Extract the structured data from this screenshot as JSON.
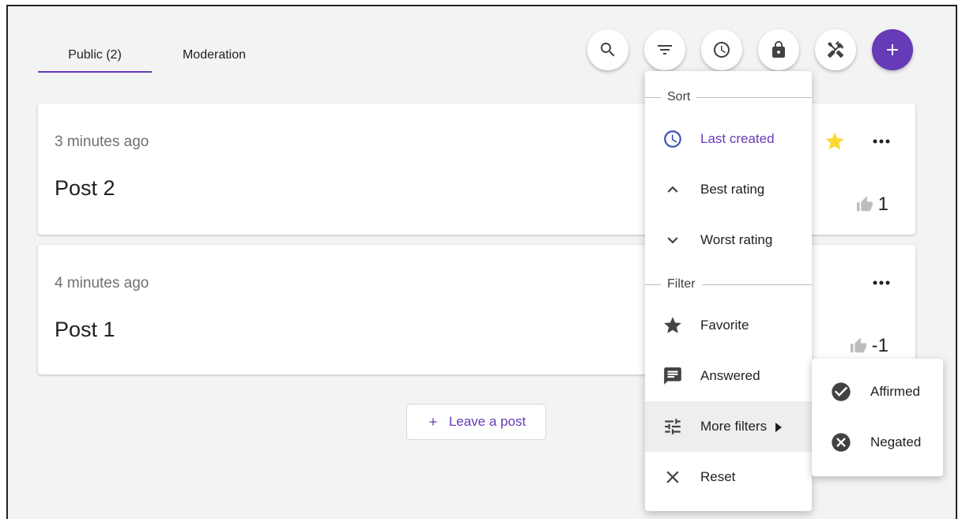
{
  "tabs": [
    {
      "label": "Public (2)",
      "active": true
    },
    {
      "label": "Moderation",
      "active": false
    }
  ],
  "toolbar": {
    "icons": [
      "search-icon",
      "filter-icon",
      "clock-icon",
      "lock-icon",
      "tools-icon",
      "add-icon"
    ],
    "accent_color": "#673ab7"
  },
  "posts": [
    {
      "time": "3 minutes ago",
      "title": "Post 2",
      "rating": "1",
      "favorite": true
    },
    {
      "time": "4 minutes ago",
      "title": "Post 1",
      "rating": "-1",
      "favorite": false
    }
  ],
  "leave_post_label": "Leave a post",
  "menu": {
    "sort_label": "Sort",
    "sort_items": [
      {
        "label": "Last created",
        "icon": "clock-icon",
        "active": true
      },
      {
        "label": "Best rating",
        "icon": "chevron-up-icon"
      },
      {
        "label": "Worst rating",
        "icon": "chevron-down-icon"
      }
    ],
    "filter_label": "Filter",
    "filter_items": [
      {
        "label": "Favorite",
        "icon": "star-icon"
      },
      {
        "label": "Answered",
        "icon": "comment-icon"
      },
      {
        "label": "More filters",
        "icon": "tune-icon"
      },
      {
        "label": "Reset",
        "icon": "close-icon"
      }
    ]
  },
  "submenu": {
    "items": [
      {
        "label": "Affirmed",
        "icon": "check-circle-icon"
      },
      {
        "label": "Negated",
        "icon": "cancel-circle-icon"
      }
    ]
  }
}
